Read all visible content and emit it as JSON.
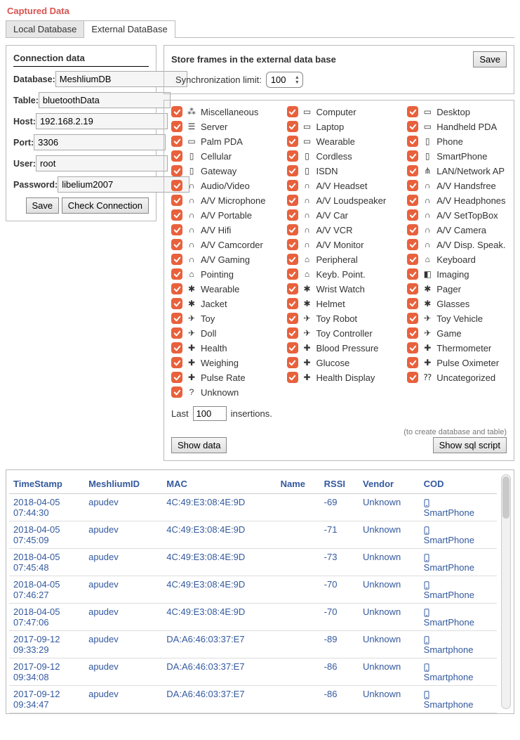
{
  "title": "Captured Data",
  "tabs": [
    "Local Database",
    "External DataBase"
  ],
  "active_tab": 1,
  "connection": {
    "title": "Connection data",
    "fields": {
      "database": {
        "label": "Database:",
        "value": "MeshliumDB"
      },
      "table": {
        "label": "Table:",
        "value": "bluetoothData"
      },
      "host": {
        "label": "Host:",
        "value": "192.168.2.19"
      },
      "port": {
        "label": "Port:",
        "value": "3306"
      },
      "user": {
        "label": "User:",
        "value": "root"
      },
      "password": {
        "label": "Password:",
        "value": "libelium2007"
      }
    },
    "save_label": "Save",
    "check_label": "Check Connection"
  },
  "sync": {
    "store_label": "Store frames in the external data base",
    "limit_label": "Synchronization limit:",
    "limit_value": "100",
    "save_label": "Save"
  },
  "filters": {
    "last_prefix": "Last",
    "last_value": "100",
    "last_suffix": "insertions.",
    "show_data_label": "Show data",
    "hint": "(to create database and table)",
    "sql_label": "Show sql script",
    "cols": [
      [
        {
          "icon": "misc",
          "label": "Miscellaneous"
        },
        {
          "icon": "server",
          "label": "Server"
        },
        {
          "icon": "pda",
          "label": "Palm PDA"
        },
        {
          "icon": "phone",
          "label": "Cellular"
        },
        {
          "icon": "phone",
          "label": "Gateway"
        },
        {
          "icon": "audio",
          "label": "Audio/Video"
        },
        {
          "icon": "audio",
          "label": "A/V Microphone"
        },
        {
          "icon": "audio",
          "label": "A/V Portable"
        },
        {
          "icon": "audio",
          "label": "A/V Hifi"
        },
        {
          "icon": "audio",
          "label": "A/V Camcorder"
        },
        {
          "icon": "audio",
          "label": "A/V Gaming"
        },
        {
          "icon": "periph",
          "label": "Pointing"
        },
        {
          "icon": "wear",
          "label": "Wearable"
        },
        {
          "icon": "wear",
          "label": "Jacket"
        },
        {
          "icon": "toy",
          "label": "Toy"
        },
        {
          "icon": "toy",
          "label": "Doll"
        },
        {
          "icon": "health",
          "label": "Health"
        },
        {
          "icon": "health",
          "label": "Weighing"
        },
        {
          "icon": "health",
          "label": "Pulse Rate"
        },
        {
          "icon": "unknown",
          "label": "Unknown"
        }
      ],
      [
        {
          "icon": "laptop",
          "label": "Computer"
        },
        {
          "icon": "laptop",
          "label": "Laptop"
        },
        {
          "icon": "laptop",
          "label": "Wearable"
        },
        {
          "icon": "phone",
          "label": "Cordless"
        },
        {
          "icon": "phone",
          "label": "ISDN"
        },
        {
          "icon": "audio",
          "label": "A/V Headset"
        },
        {
          "icon": "audio",
          "label": "A/V Loudspeaker"
        },
        {
          "icon": "audio",
          "label": "A/V Car"
        },
        {
          "icon": "audio",
          "label": "A/V VCR"
        },
        {
          "icon": "audio",
          "label": "A/V Monitor"
        },
        {
          "icon": "periph",
          "label": "Peripheral"
        },
        {
          "icon": "periph",
          "label": "Keyb. Point."
        },
        {
          "icon": "wear",
          "label": "Wrist Watch"
        },
        {
          "icon": "wear",
          "label": "Helmet"
        },
        {
          "icon": "toy",
          "label": "Toy Robot"
        },
        {
          "icon": "toy",
          "label": "Toy Controller"
        },
        {
          "icon": "health",
          "label": "Blood Pressure"
        },
        {
          "icon": "health",
          "label": "Glucose"
        },
        {
          "icon": "health",
          "label": "Health Display"
        }
      ],
      [
        {
          "icon": "laptop",
          "label": "Desktop"
        },
        {
          "icon": "laptop",
          "label": "Handheld PDA"
        },
        {
          "icon": "phone",
          "label": "Phone"
        },
        {
          "icon": "phone",
          "label": "SmartPhone"
        },
        {
          "icon": "wifi",
          "label": "LAN/Network AP"
        },
        {
          "icon": "audio",
          "label": "A/V Handsfree"
        },
        {
          "icon": "audio",
          "label": "A/V Headphones"
        },
        {
          "icon": "audio",
          "label": "A/V SetTopBox"
        },
        {
          "icon": "audio",
          "label": "A/V Camera"
        },
        {
          "icon": "audio",
          "label": "A/V Disp. Speak."
        },
        {
          "icon": "periph",
          "label": "Keyboard"
        },
        {
          "icon": "camera",
          "label": "Imaging"
        },
        {
          "icon": "wear",
          "label": "Pager"
        },
        {
          "icon": "wear",
          "label": "Glasses"
        },
        {
          "icon": "toy",
          "label": "Toy Vehicle"
        },
        {
          "icon": "toy",
          "label": "Game"
        },
        {
          "icon": "health",
          "label": "Thermometer"
        },
        {
          "icon": "health",
          "label": "Pulse Oximeter"
        },
        {
          "icon": "uncat",
          "label": "Uncategorized"
        }
      ]
    ]
  },
  "table": {
    "columns": [
      "TimeStamp",
      "MeshliumID",
      "MAC",
      "Name",
      "RSSI",
      "Vendor",
      "COD"
    ],
    "rows": [
      {
        "ts": "2018-04-05 07:44:30",
        "id": "apudev",
        "mac": "4C:49:E3:08:4E:9D",
        "name": "",
        "rssi": "-69",
        "vendor": "Unknown",
        "cod": "SmartPhone"
      },
      {
        "ts": "2018-04-05 07:45:09",
        "id": "apudev",
        "mac": "4C:49:E3:08:4E:9D",
        "name": "",
        "rssi": "-71",
        "vendor": "Unknown",
        "cod": "SmartPhone"
      },
      {
        "ts": "2018-04-05 07:45:48",
        "id": "apudev",
        "mac": "4C:49:E3:08:4E:9D",
        "name": "",
        "rssi": "-73",
        "vendor": "Unknown",
        "cod": "SmartPhone"
      },
      {
        "ts": "2018-04-05 07:46:27",
        "id": "apudev",
        "mac": "4C:49:E3:08:4E:9D",
        "name": "",
        "rssi": "-70",
        "vendor": "Unknown",
        "cod": "SmartPhone"
      },
      {
        "ts": "2018-04-05 07:47:06",
        "id": "apudev",
        "mac": "4C:49:E3:08:4E:9D",
        "name": "",
        "rssi": "-70",
        "vendor": "Unknown",
        "cod": "SmartPhone"
      },
      {
        "ts": "2017-09-12 09:33:29",
        "id": "apudev",
        "mac": "DA:A6:46:03:37:E7",
        "name": "",
        "rssi": "-89",
        "vendor": "Unknown",
        "cod": "Smartphone"
      },
      {
        "ts": "2017-09-12 09:34:08",
        "id": "apudev",
        "mac": "DA:A6:46:03:37:E7",
        "name": "",
        "rssi": "-86",
        "vendor": "Unknown",
        "cod": "Smartphone"
      },
      {
        "ts": "2017-09-12 09:34:47",
        "id": "apudev",
        "mac": "DA:A6:46:03:37:E7",
        "name": "",
        "rssi": "-86",
        "vendor": "Unknown",
        "cod": "Smartphone"
      }
    ]
  }
}
